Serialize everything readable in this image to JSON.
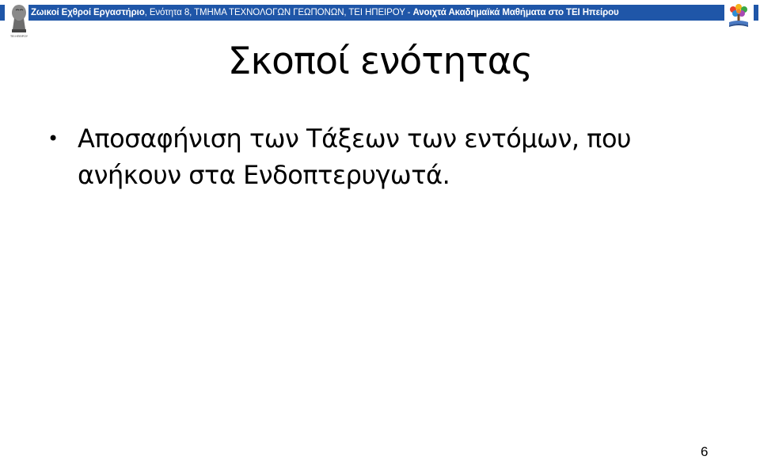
{
  "header": {
    "title_bold": "Ζωικοί Εχθροί Εργαστήριο",
    "title_rest": ", Ενότητα 8, ΤΜΗΜΑ ΤΕΧΝΟΛΟΓΩΝ ΓΕΩΠΟΝΩΝ, ΤΕΙ ΗΠΕΙΡΟΥ - ",
    "title_suffix": "Ανοιχτά Ακαδημαϊκά Μαθήματα στο ΤΕΙ Ηπείρου",
    "accent_color": "#1f56a8"
  },
  "logos": {
    "left_icon": "tei-epirus-logo",
    "left_caption": "ΤΕΙ ΗΠΕΙΡΟΥ",
    "right_icon": "open-courses-tree-logo"
  },
  "slide": {
    "title": "Σκοποί ενότητας",
    "bullets": [
      "Αποσαφήνιση των Τάξεων των εντόμων, που ανήκουν στα Ενδοπτερυγωτά."
    ],
    "bullet_glyph": "•"
  },
  "footer": {
    "page_number": "6"
  }
}
